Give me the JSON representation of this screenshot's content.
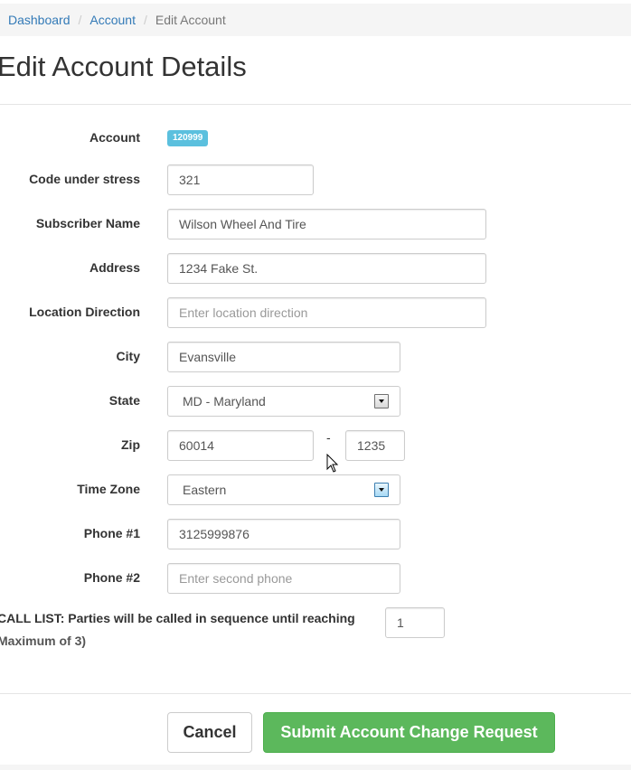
{
  "breadcrumb": {
    "items": [
      {
        "label": "Dashboard"
      },
      {
        "label": "Account"
      },
      {
        "label": "Edit Account"
      }
    ],
    "separator": "/"
  },
  "page": {
    "title": "Edit Account Details"
  },
  "form": {
    "account": {
      "label": "Account",
      "value": "120999"
    },
    "code": {
      "label": "Code under stress",
      "value": "321"
    },
    "subscriber": {
      "label": "Subscriber Name",
      "value": "Wilson Wheel And Tire"
    },
    "address": {
      "label": "Address",
      "value": "1234 Fake St."
    },
    "location": {
      "label": "Location Direction",
      "value": "",
      "placeholder": "Enter location direction"
    },
    "city": {
      "label": "City",
      "value": "Evansville"
    },
    "state": {
      "label": "State",
      "value": "MD - Maryland"
    },
    "zip": {
      "label": "Zip",
      "value": "60014",
      "separator": "-",
      "ext": "1235"
    },
    "timezone": {
      "label": "Time Zone",
      "value": "Eastern"
    },
    "phone1": {
      "label": "Phone #1",
      "value": "3125999876"
    },
    "phone2": {
      "label": "Phone #2",
      "value": "",
      "placeholder": "Enter second phone"
    },
    "calllist": {
      "label_line1": "CALL LIST: Parties will be called in sequence until reaching",
      "label_line2": "Maximum of 3)",
      "value": "1"
    }
  },
  "actions": {
    "cancel_label": "Cancel",
    "submit_label": "Submit Account Change Request"
  },
  "colors": {
    "link": "#337ab7",
    "badge": "#5bc0de",
    "submit": "#5cb85c"
  },
  "icons": {
    "select_arrow": "chevron-down-icon",
    "cursor": "mouse-pointer-icon"
  }
}
